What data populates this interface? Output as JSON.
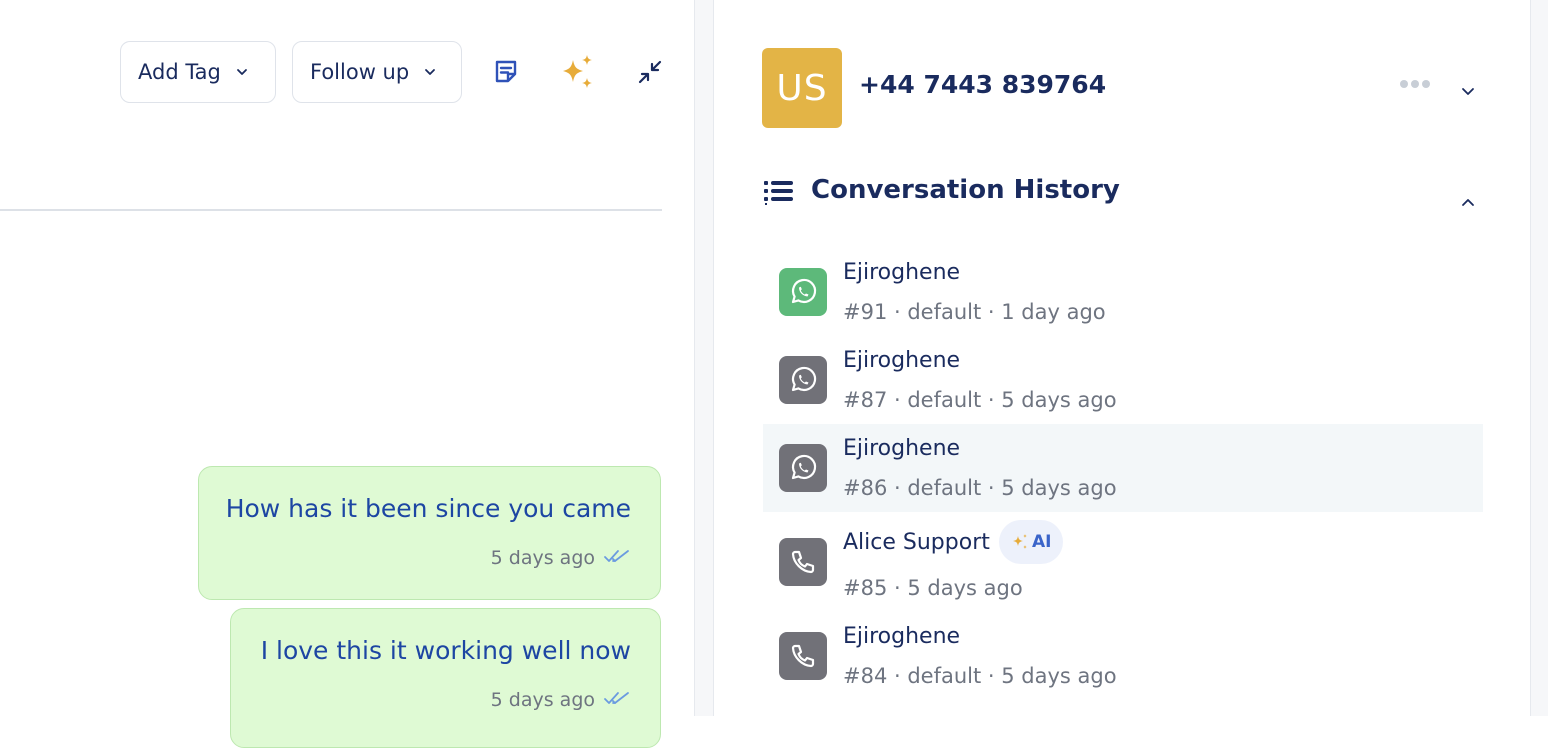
{
  "toolbar": {
    "add_tag_label": "Add Tag",
    "follow_up_label": "Follow up",
    "icons": [
      "notes-icon",
      "ai-sparkle-icon",
      "minimize-icon"
    ]
  },
  "messages": [
    {
      "text": "How has it been since you came",
      "time": "5 days ago",
      "status": "read"
    },
    {
      "text": "I love this it working well now",
      "time": "5 days ago",
      "status": "read"
    }
  ],
  "contact": {
    "initials": "US",
    "phone": "+44 7443 839764",
    "avatar_color": "#e3b446"
  },
  "history": {
    "title": "Conversation History",
    "items": [
      {
        "name": "Ejiroghene",
        "meta": "#91 · default · 1 day ago",
        "channel": "whatsapp",
        "icon_color": "#5db97a"
      },
      {
        "name": "Ejiroghene",
        "meta": "#87 · default · 5 days ago",
        "channel": "whatsapp",
        "icon_color": "#717178"
      },
      {
        "name": "Ejiroghene",
        "meta": "#86 · default · 5 days ago",
        "channel": "whatsapp",
        "icon_color": "#717178",
        "selected": true
      },
      {
        "name": "Alice Support",
        "meta": "#85 · 5 days ago",
        "channel": "phone",
        "icon_color": "#717178",
        "badge": "AI"
      },
      {
        "name": "Ejiroghene",
        "meta": "#84 · default · 5 days ago",
        "channel": "phone",
        "icon_color": "#717178"
      }
    ]
  },
  "colors": {
    "accent": "#1a2b5e",
    "bubble_bg": "#dffad4",
    "bubble_text": "#1d46a3",
    "sparkle": "#e7ac3a"
  }
}
